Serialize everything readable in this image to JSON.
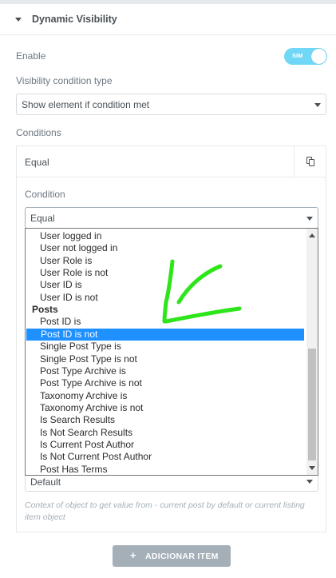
{
  "section": {
    "title": "Dynamic Visibility"
  },
  "enable": {
    "label": "Enable",
    "toggle_text": "SIM",
    "state": true
  },
  "visibility_type": {
    "label": "Visibility condition type",
    "value": "Show element if condition met"
  },
  "conditions": {
    "label": "Conditions",
    "item_title": "Equal",
    "condition_label": "Condition",
    "condition_value": "Equal",
    "context_value": "Default",
    "context_note": "Context of object to get value from - current post by default or current listing item object"
  },
  "dropdown": {
    "items": [
      {
        "label": "User logged in",
        "type": "option"
      },
      {
        "label": "User not logged in",
        "type": "option"
      },
      {
        "label": "User Role is",
        "type": "option"
      },
      {
        "label": "User Role is not",
        "type": "option"
      },
      {
        "label": "User ID is",
        "type": "option"
      },
      {
        "label": "User ID is not",
        "type": "option"
      },
      {
        "label": "Posts",
        "type": "group"
      },
      {
        "label": "Post ID is",
        "type": "option"
      },
      {
        "label": "Post ID is not",
        "type": "option",
        "selected": true
      },
      {
        "label": "Single Post Type is",
        "type": "option"
      },
      {
        "label": "Single Post Type is not",
        "type": "option"
      },
      {
        "label": "Post Type Archive is",
        "type": "option"
      },
      {
        "label": "Post Type Archive is not",
        "type": "option"
      },
      {
        "label": "Taxonomy Archive is",
        "type": "option"
      },
      {
        "label": "Taxonomy Archive is not",
        "type": "option"
      },
      {
        "label": "Is Search Results",
        "type": "option"
      },
      {
        "label": "Is Not Search Results",
        "type": "option"
      },
      {
        "label": "Is Current Post Author",
        "type": "option"
      },
      {
        "label": "Is Not Current Post Author",
        "type": "option"
      },
      {
        "label": "Post Has Terms",
        "type": "option"
      }
    ],
    "selected_color": "#1e90ff"
  },
  "add_button": {
    "icon": "plus-icon",
    "label": "ADICIONAR ITEM"
  },
  "colors": {
    "toggle_on": "#71d7f7",
    "annotation": "#2ee51a",
    "button_bg": "#a4afb7"
  }
}
